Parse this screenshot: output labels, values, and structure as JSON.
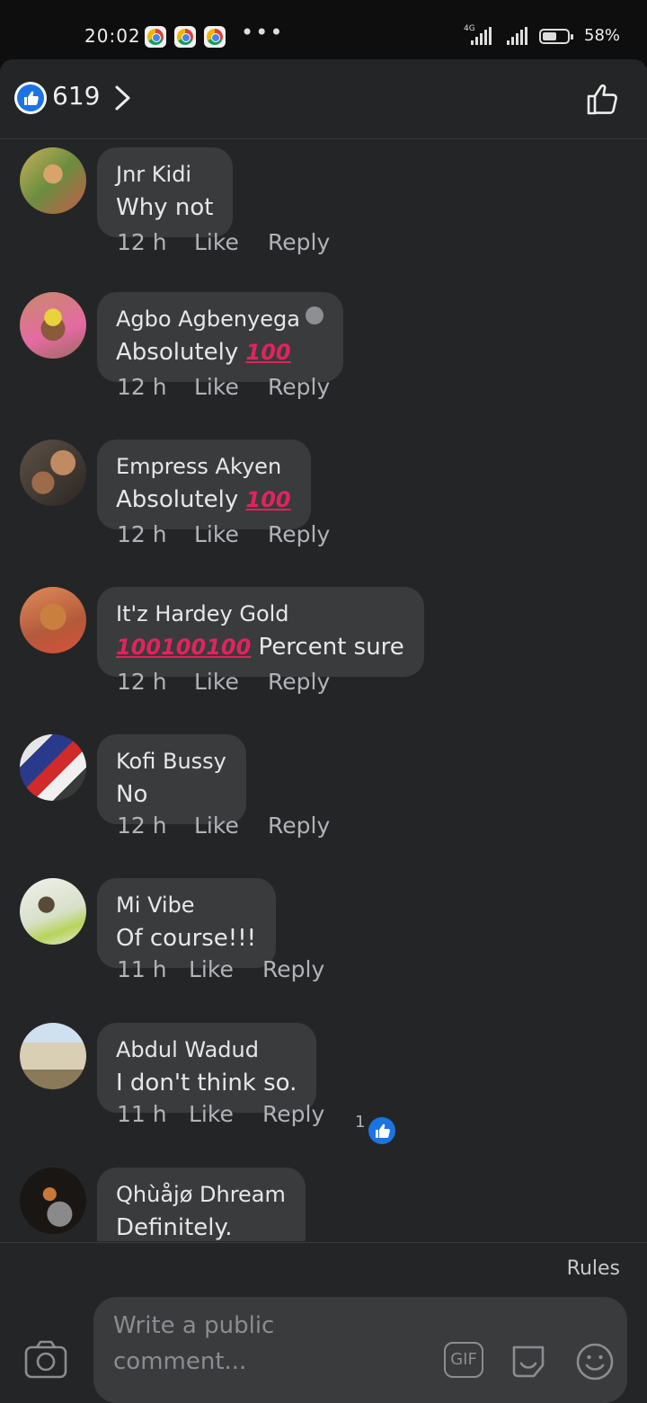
{
  "status_bar": {
    "time": "20:02",
    "more": "•••",
    "network": "4G",
    "battery": "58%",
    "battery_level": 0.58
  },
  "header": {
    "like_count": "619",
    "reaction_icon": "thumbs-up-icon",
    "action_icon": "thumbs-up-outline-icon"
  },
  "comments": [
    {
      "name": "Jnr Kidi",
      "text": "Why not",
      "time": "12 h",
      "like": "Like",
      "reply": "Reply"
    },
    {
      "name": "Agbo Agbenyega",
      "text": "Absolutely ",
      "emoji": "100",
      "time": "12 h",
      "like": "Like",
      "reply": "Reply"
    },
    {
      "name": "Empress Akyen",
      "text": "Absolutely ",
      "emoji": "100",
      "time": "12 h",
      "like": "Like",
      "reply": "Reply"
    },
    {
      "name": "It'z Hardey Gold",
      "emoji": "100100100",
      "text": " Percent sure",
      "time": "12 h",
      "like": "Like",
      "reply": "Reply"
    },
    {
      "name": "Kofi Bussy",
      "text": "No",
      "time": "12 h",
      "like": "Like",
      "reply": "Reply"
    },
    {
      "name": "Mi Vibe",
      "text": "Of course!!!",
      "time": "11 h",
      "like": "Like",
      "reply": "Reply"
    },
    {
      "name": "Abdul Wadud",
      "text": "I don't think so.",
      "time": "11 h",
      "like": "Like",
      "reply": "Reply",
      "reactions": "1"
    },
    {
      "name": "Qhùåjø Dhream",
      "text": "Definitely."
    }
  ],
  "footer": {
    "rules": "Rules",
    "placeholder": "Write a public comment...",
    "gif_label": "GIF"
  },
  "colors": {
    "background": "#242526",
    "bubble": "#3a3b3c",
    "accent": "#1b74e4",
    "emoji_red": "#e0245e"
  }
}
